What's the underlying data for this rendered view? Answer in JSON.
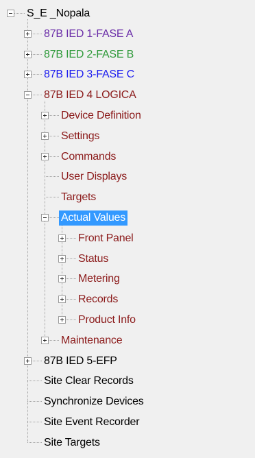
{
  "colors": {
    "default": "#000000",
    "dark_red": "#8b1a1a",
    "purple": "#6a2da8",
    "green": "#2f9a3a",
    "blue": "#1c1cf0",
    "selection": "#3399ff"
  },
  "tree": {
    "root": {
      "label": "S_E _Nopala",
      "expanded": true
    },
    "items": [
      {
        "label": "87B IED 1-FASE A",
        "color": "#6a2da8",
        "expandable": true,
        "expanded": false
      },
      {
        "label": "87B IED 2-FASE B",
        "color": "#2f9a3a",
        "expandable": true,
        "expanded": false
      },
      {
        "label": "87B IED 3-FASE C",
        "color": "#1c1cf0",
        "expandable": true,
        "expanded": false
      },
      {
        "label": "87B IED 4 LOGICA",
        "color": "#8b1a1a",
        "expandable": true,
        "expanded": true
      },
      {
        "label": "Device Definition",
        "color": "#8b1a1a",
        "expandable": true,
        "expanded": false
      },
      {
        "label": "Settings",
        "color": "#8b1a1a",
        "expandable": true,
        "expanded": false
      },
      {
        "label": "Commands",
        "color": "#8b1a1a",
        "expandable": true,
        "expanded": false
      },
      {
        "label": "User Displays",
        "color": "#8b1a1a",
        "expandable": false
      },
      {
        "label": "Targets",
        "color": "#8b1a1a",
        "expandable": false
      },
      {
        "label": "Actual Values",
        "color": "#8b1a1a",
        "expandable": true,
        "expanded": true,
        "selected": true
      },
      {
        "label": "Front Panel",
        "color": "#8b1a1a",
        "expandable": true,
        "expanded": false
      },
      {
        "label": "Status",
        "color": "#8b1a1a",
        "expandable": true,
        "expanded": false
      },
      {
        "label": "Metering",
        "color": "#8b1a1a",
        "expandable": true,
        "expanded": false
      },
      {
        "label": "Records",
        "color": "#8b1a1a",
        "expandable": true,
        "expanded": false
      },
      {
        "label": "Product Info",
        "color": "#8b1a1a",
        "expandable": true,
        "expanded": false
      },
      {
        "label": "Maintenance",
        "color": "#8b1a1a",
        "expandable": true,
        "expanded": false
      },
      {
        "label": "87B IED 5-EFP",
        "color": "#000000",
        "expandable": true,
        "expanded": false
      },
      {
        "label": "Site Clear Records",
        "color": "#000000",
        "expandable": false
      },
      {
        "label": "Synchronize Devices",
        "color": "#000000",
        "expandable": false
      },
      {
        "label": "Site Event Recorder",
        "color": "#000000",
        "expandable": false
      },
      {
        "label": "Site Targets",
        "color": "#000000",
        "expandable": false
      }
    ]
  }
}
